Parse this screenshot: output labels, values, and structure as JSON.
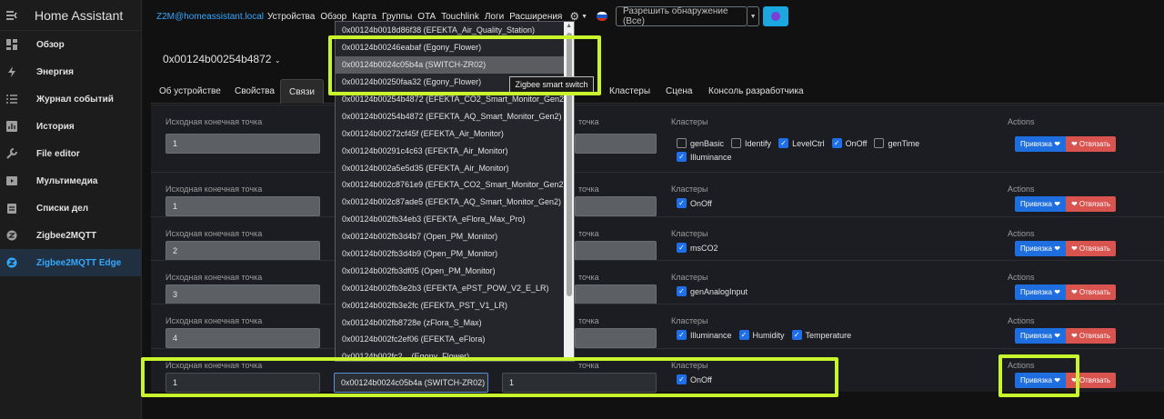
{
  "sidebar": {
    "title": "Home Assistant",
    "items": [
      {
        "label": "Обзор",
        "icon": "dashboard-icon"
      },
      {
        "label": "Энергия",
        "icon": "lightning-icon"
      },
      {
        "label": "Журнал событий",
        "icon": "list-icon"
      },
      {
        "label": "История",
        "icon": "chart-icon"
      },
      {
        "label": "File editor",
        "icon": "wrench-icon"
      },
      {
        "label": "Мультимедиа",
        "icon": "play-icon"
      },
      {
        "label": "Списки дел",
        "icon": "clipboard-icon"
      },
      {
        "label": "Zigbee2MQTT",
        "icon": "zigbee-icon"
      },
      {
        "label": "Zigbee2MQTT Edge",
        "icon": "zigbee-icon",
        "active": true
      }
    ]
  },
  "topnav": {
    "brand": "Z2M@homeassistant.local",
    "links": [
      "Устройства",
      "Обзор",
      "Карта",
      "Группы",
      "OTA",
      "Touchlink",
      "Логи",
      "Расширения"
    ],
    "permit_label": "Разрешить обнаружение (Все)"
  },
  "device": {
    "title": "0x00124b00254b4872"
  },
  "tabs": [
    "Об устройстве",
    "Свойства",
    "Связи",
    "Кластеры",
    "Сцена",
    "Консоль разработчика"
  ],
  "bind_labels": {
    "source_endpoint": "Исходная конечная точка",
    "target_endpoint": "точка",
    "clusters": "Кластеры",
    "actions": "Actions",
    "bind": "Привязка",
    "unbind": "Отвязать"
  },
  "bind_rows": [
    {
      "endpoint": "1",
      "clusters": [
        {
          "name": "genBasic",
          "checked": false
        },
        {
          "name": "Identify",
          "checked": false
        },
        {
          "name": "LevelCtrl",
          "checked": true
        },
        {
          "name": "OnOff",
          "checked": true
        },
        {
          "name": "genTime",
          "checked": false
        },
        {
          "name": "Illuminance",
          "checked": true
        }
      ]
    },
    {
      "endpoint": "1",
      "clusters": [
        {
          "name": "OnOff",
          "checked": true
        }
      ]
    },
    {
      "endpoint": "2",
      "clusters": [
        {
          "name": "msCO2",
          "checked": true
        }
      ]
    },
    {
      "endpoint": "3",
      "clusters": [
        {
          "name": "genAnalogInput",
          "checked": true
        }
      ]
    },
    {
      "endpoint": "4",
      "clusters": [
        {
          "name": "Illuminance",
          "checked": true
        },
        {
          "name": "Humidity",
          "checked": true
        },
        {
          "name": "Temperature",
          "checked": true
        }
      ]
    },
    {
      "endpoint": "1",
      "device": "0x00124b0024c05b4a (SWITCH-ZR02)",
      "target_endpoint": "1",
      "clusters": [
        {
          "name": "OnOff",
          "checked": true
        }
      ]
    }
  ],
  "dropdown": {
    "selected_index": 2,
    "options": [
      "0x00124b0018d86f38 (EFEKTA_Air_Quality_Station)",
      "0x00124b00246eabaf (Egony_Flower)",
      "0x00124b0024c05b4a (SWITCH-ZR02)",
      "0x00124b00250faa32 (Egony_Flower)",
      "0x00124b00254b4872 (EFEKTA_CO2_Smart_Monitor_Gen2)",
      "0x00124b00254b4872 (EFEKTA_AQ_Smart_Monitor_Gen2)",
      "0x00124b00272cf45f (EFEKTA_Air_Monitor)",
      "0x00124b00291c4c63 (EFEKTA_Air_Monitor)",
      "0x00124b002a5e5d35 (EFEKTA_Air_Monitor)",
      "0x00124b002c8761e9 (EFEKTA_CO2_Smart_Monitor_Gen2)",
      "0x00124b002c87ade5 (EFEKTA_AQ_Smart_Monitor_Gen2)",
      "0x00124b002fb34eb3 (EFEKTA_eFlora_Max_Pro)",
      "0x00124b002fb3d4b7 (Open_PM_Monitor)",
      "0x00124b002fb3d4b9 (Open_PM_Monitor)",
      "0x00124b002fb3df05 (Open_PM_Monitor)",
      "0x00124b002fb3e2b3 (EFEKTA_ePST_POW_V2_E_LR)",
      "0x00124b002fb3e2fc (EFEKTA_PST_V1_LR)",
      "0x00124b002fb8728e (zFlora_S_Max)",
      "0x00124b002fc2ef06 (EFEKTA_eFlora)",
      "0x00124b002fc2... (Egony_Flower)"
    ],
    "tooltip": "Zigbee smart switch"
  },
  "colors": {
    "accent": "#33a8ff",
    "highlight": "#c8f52b",
    "bind": "#1e6ee0",
    "unbind": "#d9534f"
  }
}
